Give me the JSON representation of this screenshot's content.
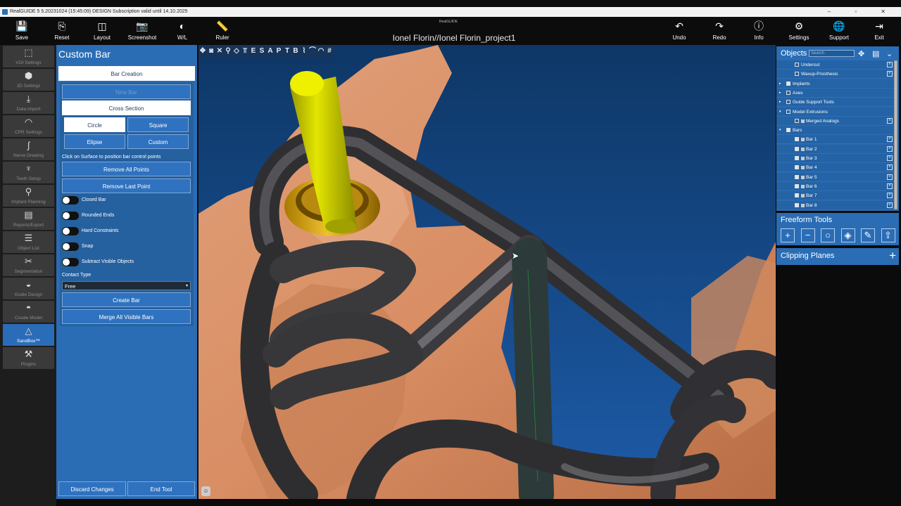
{
  "titlebar": {
    "text": "RealGUIDE 5   5.20231024 (15:45:09)  DESIGN Subscription valid until  14.10.2025",
    "window_controls": "– ▫ ✕"
  },
  "toolbar": {
    "left": [
      {
        "label": "Save",
        "icon": "save-icon",
        "glyph": "💾"
      },
      {
        "label": "Reset",
        "icon": "reset-icon",
        "glyph": "⎘"
      },
      {
        "label": "Layout",
        "icon": "layout-icon",
        "glyph": "◫"
      },
      {
        "label": "Screenshot",
        "icon": "camera-icon",
        "glyph": "📷"
      },
      {
        "label": "W/L",
        "icon": "contrast-icon",
        "glyph": "◐"
      },
      {
        "label": "Ruler",
        "icon": "ruler-icon",
        "glyph": "📏"
      }
    ],
    "right": [
      {
        "label": "Undo",
        "icon": "undo-icon",
        "glyph": "↶"
      },
      {
        "label": "Redo",
        "icon": "redo-icon",
        "glyph": "↷"
      },
      {
        "label": "Info",
        "icon": "info-icon",
        "glyph": "ⓘ"
      },
      {
        "label": "Settings",
        "icon": "gear-icon",
        "glyph": "⚙"
      },
      {
        "label": "Support",
        "icon": "globe-icon",
        "glyph": "🌐"
      },
      {
        "label": "Exit",
        "icon": "exit-icon",
        "glyph": "⇥"
      }
    ],
    "project_title": "Ionel Florin//Ionel Florin_project1",
    "brand": "RealGUIDE"
  },
  "nav": [
    {
      "label": "VOI Settings",
      "glyph": "⬚",
      "icon": "cube-outline-icon",
      "active": false
    },
    {
      "label": "3D Settings",
      "glyph": "⬢",
      "icon": "cube-3d-icon",
      "active": false
    },
    {
      "label": "Data Import",
      "glyph": "⤓",
      "icon": "download-icon",
      "active": false
    },
    {
      "label": "CPR Settings",
      "glyph": "◠",
      "icon": "arc-dots-icon",
      "active": false
    },
    {
      "label": "Nerve Drawing",
      "glyph": "∫",
      "icon": "nerve-icon",
      "active": false
    },
    {
      "label": "Teeth Setup",
      "glyph": "♆",
      "icon": "tooth-icon",
      "active": false
    },
    {
      "label": "Implant Planning",
      "glyph": "⚲",
      "icon": "implant-icon",
      "active": false
    },
    {
      "label": "Reports/Export",
      "glyph": "▤",
      "icon": "report-icon",
      "active": false
    },
    {
      "label": "Object List",
      "glyph": "☰",
      "icon": "list-edit-icon",
      "active": false
    },
    {
      "label": "Segmentation",
      "glyph": "✂",
      "icon": "wand-icon",
      "active": false
    },
    {
      "label": "Guide Design",
      "glyph": "◒",
      "icon": "guide-icon",
      "active": false
    },
    {
      "label": "Create Model",
      "glyph": "◓",
      "icon": "model-icon",
      "active": false
    },
    {
      "label": "SandBox™",
      "glyph": "△",
      "icon": "shapes-icon",
      "active": true
    },
    {
      "label": "Plugins",
      "glyph": "⚒",
      "icon": "plugin-icon",
      "active": false
    }
  ],
  "panel": {
    "title": "Custom Bar",
    "bar_creation": "Bar Creation",
    "new_bar": "New Bar",
    "cross_section": "Cross Section",
    "circle": "Circle",
    "square": "Square",
    "elipse": "Elipse",
    "custom": "Custom",
    "instruction": "Click on Surface to position bar control points",
    "remove_all": "Remove All Points",
    "remove_last": "Remove Last Point",
    "toggles": [
      "Closed Bar",
      "Rounded Ends",
      "Hard Constraints",
      "Snap",
      "Subtract Visible Objects"
    ],
    "contact_type_label": "Contact Type",
    "contact_type_value": "Free",
    "create_bar": "Create Bar",
    "merge_bars": "Merge All Visible Bars",
    "discard": "Discard Changes",
    "end_tool": "End Tool"
  },
  "viewport": {
    "tools": [
      "✥",
      "◙",
      "✕",
      "⚲",
      "◇",
      "⫪",
      "E",
      "S",
      "A",
      "P",
      "T",
      "B",
      "⌇",
      "⌒",
      "◠",
      "#"
    ],
    "tool_names": [
      "move-icon",
      "camera-icon",
      "close-icon",
      "implant-icon",
      "eraser-icon",
      "fork-icon",
      "e-icon",
      "s-icon",
      "a-icon",
      "p-icon",
      "t-icon",
      "b-icon",
      "bar-tool-icon",
      "curve-icon",
      "arc-icon",
      "grid-icon"
    ],
    "colors": {
      "background_top": "#0e3766",
      "background_bottom": "#1d5ba8",
      "gingiva": "#d98e64",
      "bar": "#3f3f42",
      "implant": "#e3e600",
      "sleeve": "#d7a20a"
    }
  },
  "objects": {
    "title": "Objects",
    "search_placeholder": "Search",
    "rows": [
      {
        "label": "Undercut",
        "indent": 2,
        "expander": "",
        "checked": false,
        "swatch": false,
        "menu": true
      },
      {
        "label": "Waxup-Prosthesis",
        "indent": 2,
        "expander": "",
        "checked": false,
        "swatch": false,
        "menu": true
      },
      {
        "label": "Implants",
        "indent": 0,
        "expander": "▸",
        "checked": true,
        "swatch": false,
        "menu": false
      },
      {
        "label": "Axes",
        "indent": 0,
        "expander": "▸",
        "checked": false,
        "swatch": false,
        "menu": false
      },
      {
        "label": "Guide Support Tools",
        "indent": 0,
        "expander": "▸",
        "checked": false,
        "swatch": false,
        "menu": false
      },
      {
        "label": "Model Extrusions",
        "indent": 0,
        "expander": "▾",
        "checked": false,
        "swatch": false,
        "menu": false
      },
      {
        "label": "Merged Analogs",
        "indent": 2,
        "expander": "",
        "checked": false,
        "swatch": true,
        "menu": true
      },
      {
        "label": "Bars",
        "indent": 0,
        "expander": "▾",
        "checked": true,
        "swatch": false,
        "menu": false
      },
      {
        "label": "Bar 1",
        "indent": 2,
        "expander": "",
        "checked": true,
        "swatch": true,
        "menu": true
      },
      {
        "label": "Bar 2",
        "indent": 2,
        "expander": "",
        "checked": true,
        "swatch": true,
        "menu": true
      },
      {
        "label": "Bar 3",
        "indent": 2,
        "expander": "",
        "checked": true,
        "swatch": true,
        "menu": true
      },
      {
        "label": "Bar 4",
        "indent": 2,
        "expander": "",
        "checked": true,
        "swatch": true,
        "menu": true
      },
      {
        "label": "Bar 5",
        "indent": 2,
        "expander": "",
        "checked": true,
        "swatch": true,
        "menu": true
      },
      {
        "label": "Bar 6",
        "indent": 2,
        "expander": "",
        "checked": true,
        "swatch": true,
        "menu": true
      },
      {
        "label": "Bar 7",
        "indent": 2,
        "expander": "",
        "checked": true,
        "swatch": true,
        "menu": true
      },
      {
        "label": "Bar 8",
        "indent": 2,
        "expander": "",
        "checked": true,
        "swatch": true,
        "menu": true
      }
    ]
  },
  "freeform": {
    "title": "Freeform Tools",
    "tools": [
      {
        "glyph": "+",
        "name": "add-material-icon"
      },
      {
        "glyph": "−",
        "name": "remove-material-icon"
      },
      {
        "glyph": "○",
        "name": "smooth-icon"
      },
      {
        "glyph": "◈",
        "name": "fill-icon"
      },
      {
        "glyph": "✎",
        "name": "brush-icon"
      },
      {
        "glyph": "⇧",
        "name": "extrude-icon"
      }
    ]
  },
  "clipping": {
    "title": "Clipping Planes",
    "add_glyph": "+"
  }
}
